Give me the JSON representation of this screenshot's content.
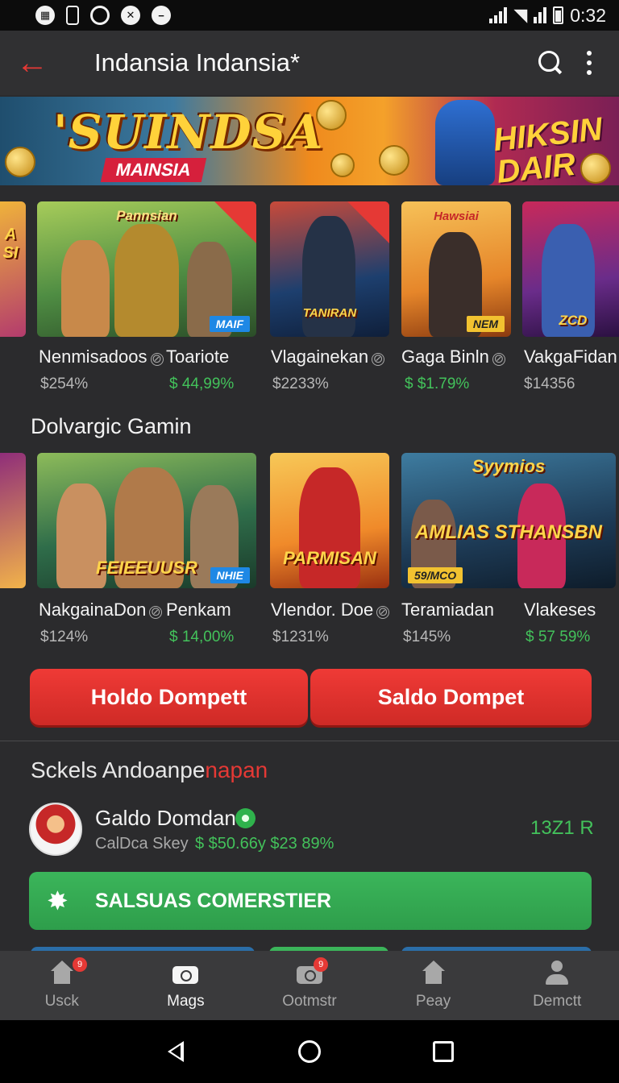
{
  "status": {
    "time": "0:32",
    "left_icons": [
      "news-icon",
      "phone-icon",
      "sync-icon",
      "xbox-icon",
      "minus-icon"
    ]
  },
  "app_bar": {
    "title": "Indansia Indansia*"
  },
  "banner": {
    "title": "'SUINDSA",
    "subtitle": "MAINSIA",
    "right_text": "HIKSIN DAIR"
  },
  "games_row1": [
    {
      "name": "",
      "price": "",
      "logo": "A SI",
      "palette": [
        "#b33b6d",
        "#f0b43a"
      ]
    },
    {
      "name": "Nenmisadoos",
      "price": "$254%",
      "logo": "Pannsian",
      "badge": "MAIF",
      "palette": [
        "#4f8d43",
        "#a7cc5a"
      ]
    },
    {
      "name": "Toariote",
      "price": "$ 44,99%",
      "price_green": true
    },
    {
      "name": "Vlagainekan",
      "price": "$2233%",
      "logo": "TANIRAN",
      "palette": [
        "#1d3f6e",
        "#b33838"
      ]
    },
    {
      "name": "Gaga Binln",
      "price": "$ $1.79%",
      "price_green": true,
      "logo": "Hawsiai",
      "badge": "NEM",
      "palette": [
        "#e6862a",
        "#f6c158"
      ]
    },
    {
      "name": "VakgaFidan",
      "price": "$14356",
      "logo": "ZCD",
      "palette": [
        "#6a2c8a",
        "#c8295a"
      ]
    }
  ],
  "section2": {
    "title": "Dolvargic Gamin"
  },
  "games_row2": [
    {
      "name": "",
      "price": "",
      "palette": [
        "#8e2c7a",
        "#f2b34a"
      ]
    },
    {
      "name": "NakgainaDon",
      "price": "$124%",
      "logo": "FEIEEUUSR",
      "badge": "NHIE",
      "palette": [
        "#2f6d4a",
        "#8dbb5a"
      ]
    },
    {
      "name": "Penkam",
      "price": "$ 14,00%",
      "price_green": true
    },
    {
      "name": "Vlendor. Doe",
      "price": "$1231%",
      "logo": "PARMISAN",
      "palette": [
        "#f08a2a",
        "#f7c857"
      ]
    },
    {
      "name": "Teramiadan",
      "price": "$145%",
      "logo": "AMLIAS STHANSBN",
      "logo_top": "Syymios",
      "badge": "59/MCO",
      "palette": [
        "#1d3a55",
        "#3e7ca0"
      ]
    },
    {
      "name": "Vlakeses",
      "price": "$ 57 59%",
      "price_green": true
    }
  ],
  "actions": {
    "left_button": "Holdo Dompett",
    "right_button": "Saldo Dompet"
  },
  "recent": {
    "title_main": "Sckels Andoanpe",
    "title_accent": "napan",
    "user_name": "Galdo Domdan",
    "user_sub": "CalDca Skey",
    "user_amount": "$ $50.66y $23 89%",
    "user_score": "13Z1 R",
    "promo_label": "SALSUAS COMERSTIER"
  },
  "bottom_nav": [
    {
      "label": "Usck",
      "icon": "home-icon",
      "badge": "9"
    },
    {
      "label": "Mags",
      "icon": "camera-icon",
      "active": true
    },
    {
      "label": "Ootmstr",
      "icon": "camera-icon",
      "badge": "9"
    },
    {
      "label": "Peay",
      "icon": "home-icon"
    },
    {
      "label": "Demctt",
      "icon": "profile-icon"
    }
  ],
  "colors": {
    "accent_red": "#e53935",
    "accent_green": "#43c25b",
    "background": "#2b2b2d"
  }
}
